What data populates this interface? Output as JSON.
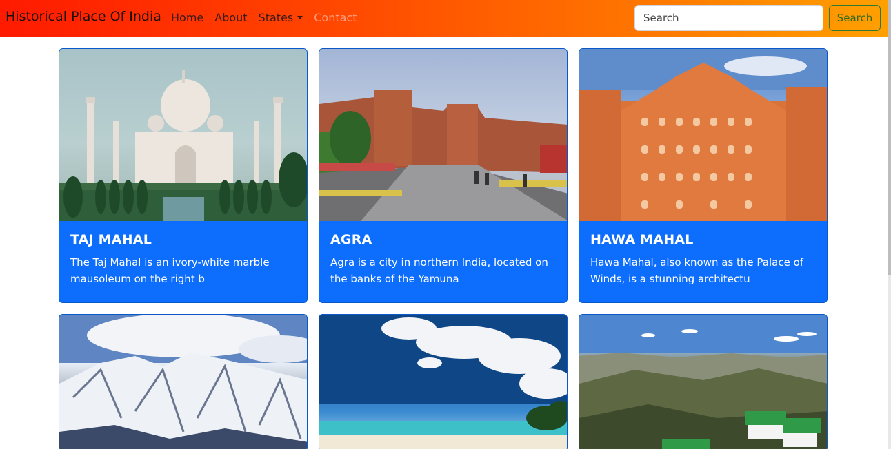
{
  "navbar": {
    "brand": "Historical Place Of India",
    "links": [
      {
        "label": "Home"
      },
      {
        "label": "About"
      },
      {
        "label": "States"
      },
      {
        "label": "Contact"
      }
    ],
    "search": {
      "placeholder": "Search",
      "button_label": "Search"
    }
  },
  "cards": [
    {
      "title": "TAJ MAHAL",
      "text": "The Taj Mahal is an ivory-white marble mausoleum on the right b"
    },
    {
      "title": "AGRA",
      "text": "Agra is a city in northern India, located on the banks of the Yamuna"
    },
    {
      "title": "HAWA MAHAL",
      "text": "Hawa Mahal, also known as the Palace of Winds, is a stunning architectu"
    }
  ],
  "colors": {
    "navbar_gradient_start": "#ff1a00",
    "navbar_gradient_end": "#ffa000",
    "card_bg": "#0d6efd",
    "card_border": "#0a58ca",
    "search_button_border": "#2f7a2f"
  }
}
